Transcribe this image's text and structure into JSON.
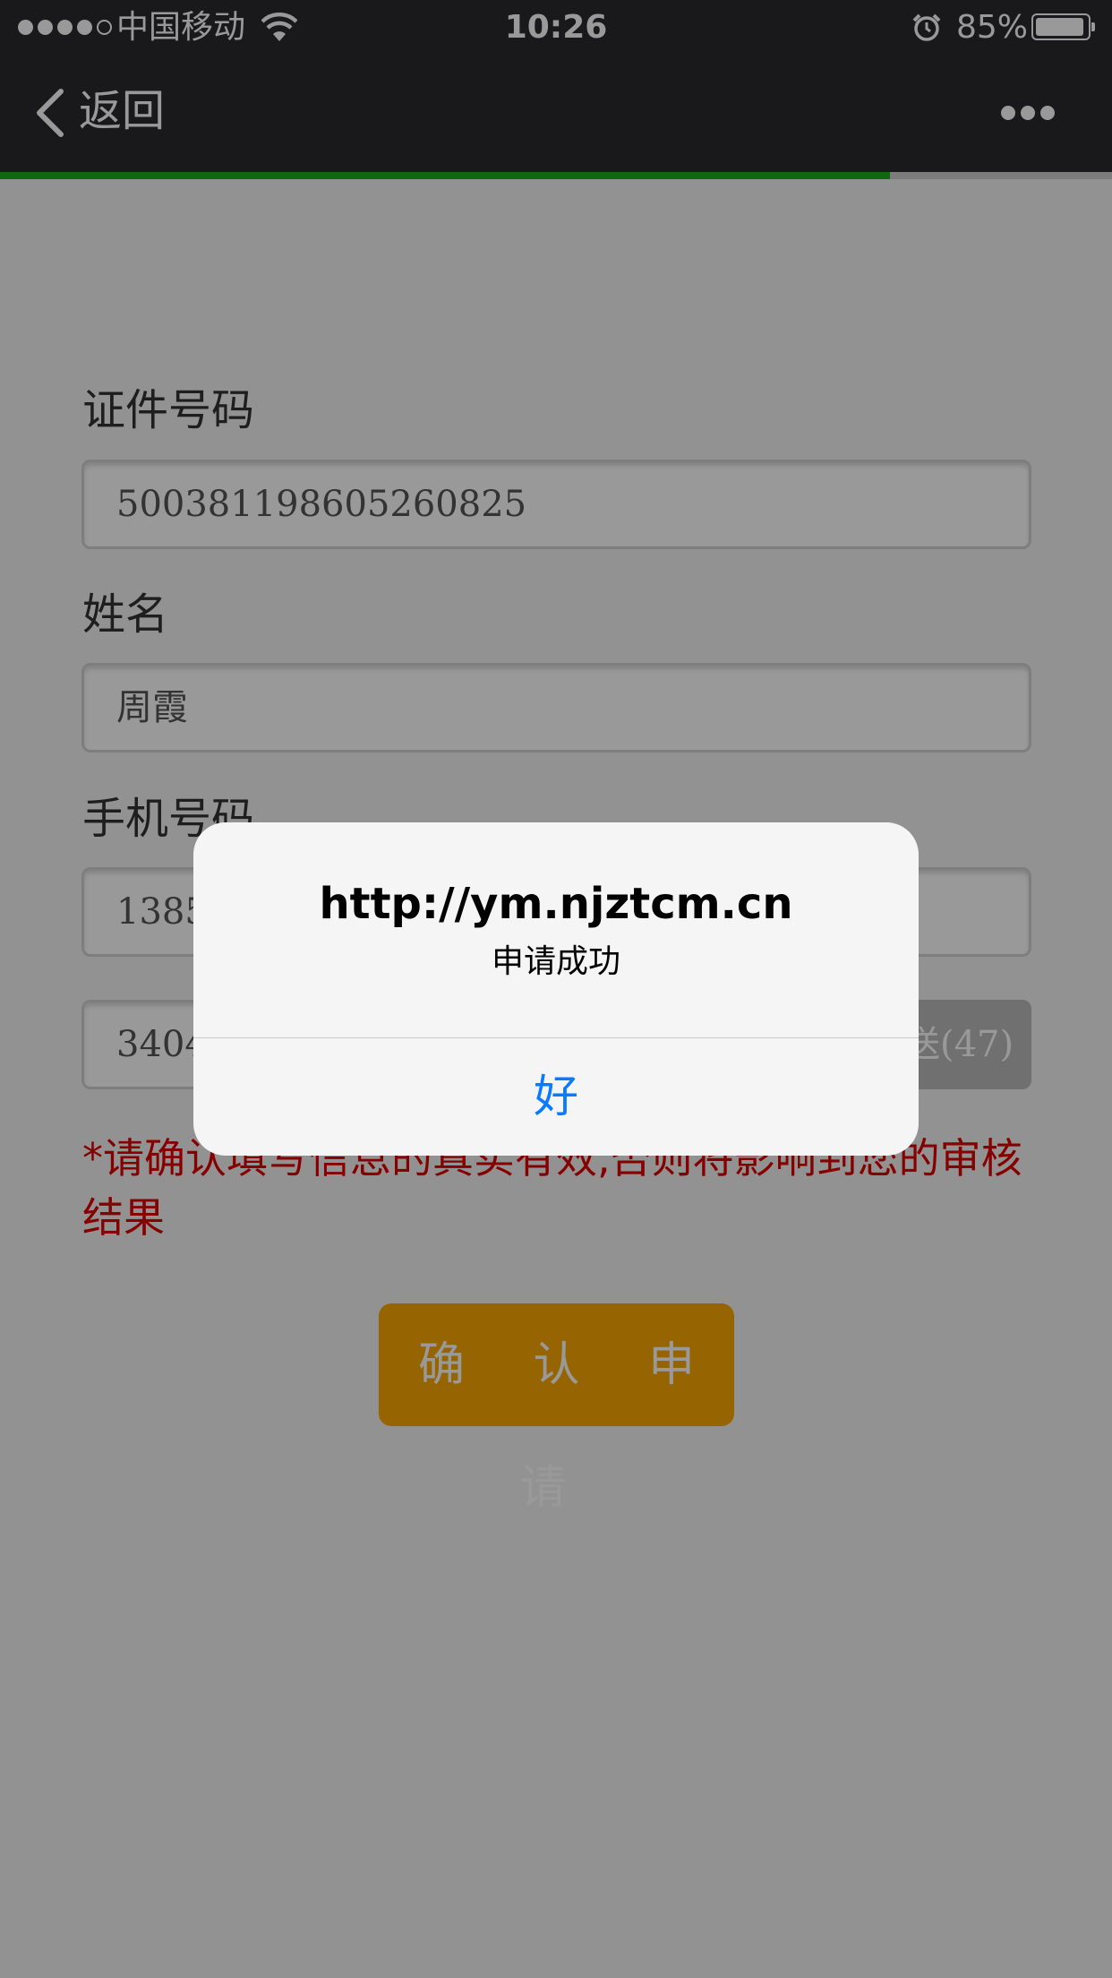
{
  "status_bar": {
    "carrier": "中国移动",
    "time": "10:26",
    "battery": "85%",
    "battery_level": 0.85,
    "signal_bars": 4,
    "icons": [
      "signal-dots-icon",
      "wifi-icon",
      "alarm-icon",
      "battery-icon"
    ]
  },
  "nav": {
    "back_label": "返回",
    "back_icon": "chevron-left-icon",
    "more_icon": "more-dots-icon",
    "load_progress": 0.8
  },
  "form": {
    "id_label": "证件号码",
    "id_value": "500381198605260825",
    "name_label": "姓名",
    "name_value": "周霞",
    "phone_label": "手机号码",
    "phone_value": "1385",
    "code_value": "3404",
    "send_button": "送(47)",
    "warning": "*请确认填写信息的真实有效,否则将影响到您的审核结果",
    "confirm_button": "确 认 申 请"
  },
  "dialog": {
    "title": "http://ym.njztcm.cn",
    "message": "申请成功",
    "ok_button": "好"
  },
  "colors": {
    "nav_bg": "#2a2a2f",
    "progress": "#1aad19",
    "confirm_bg": "#fba700",
    "warning_text": "#e00000",
    "dialog_button": "#0a7aff"
  }
}
